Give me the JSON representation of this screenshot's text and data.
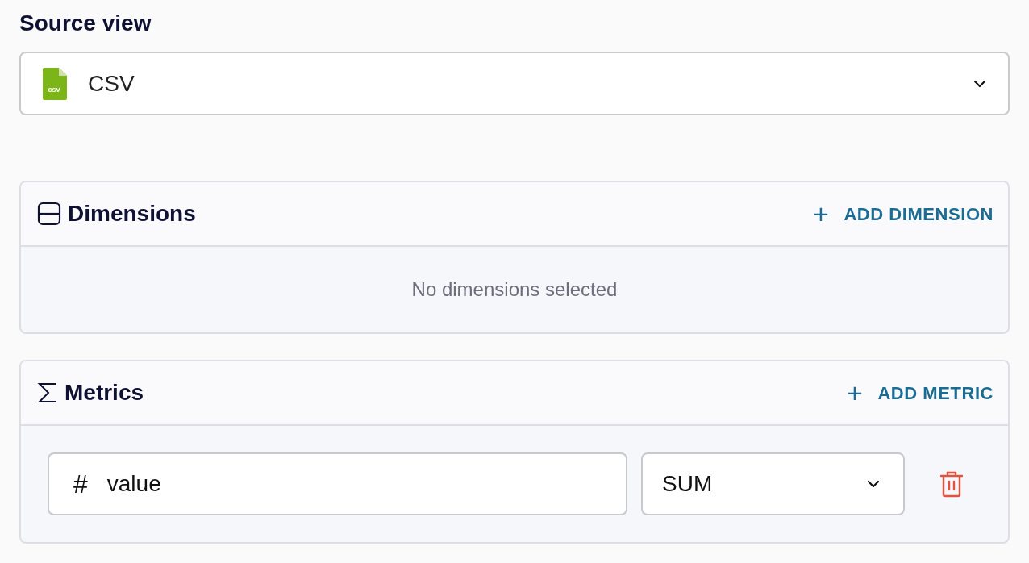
{
  "source_view": {
    "label": "Source view",
    "file_badge": "csv",
    "value": "CSV"
  },
  "sections": [
    {
      "kind": "dimensions",
      "title": "Dimensions",
      "action": "+",
      "action_label": "ADD DIMENSION",
      "empty_text": "No dimensions selected"
    },
    {
      "kind": "metrics",
      "title": "Metrics",
      "action": "+",
      "action_label": "ADD METRIC",
      "rows": [
        {
          "symbol": "#",
          "field": "value",
          "aggregation": "SUM"
        }
      ]
    }
  ]
}
